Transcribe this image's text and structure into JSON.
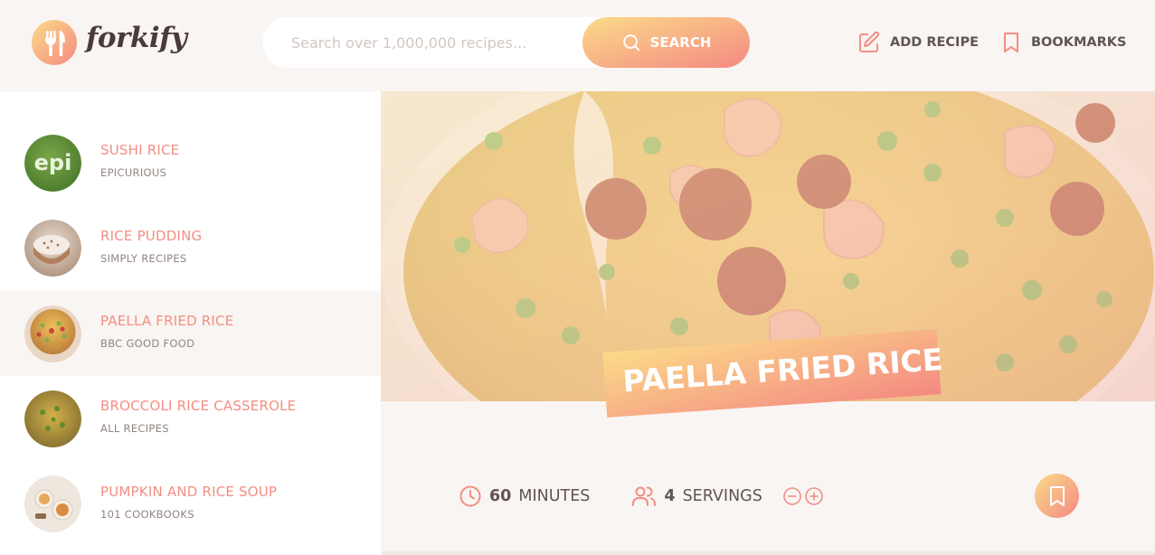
{
  "app": {
    "logo_text": "forkify"
  },
  "search": {
    "placeholder": "Search over 1,000,000 recipes...",
    "button_label": "Search"
  },
  "nav": {
    "add_recipe": "Add recipe",
    "bookmarks": "Bookmarks"
  },
  "results": [
    {
      "title": "Sushi Rice",
      "publisher": "Epicurious",
      "thumb_text": "epi",
      "active": false
    },
    {
      "title": "Rice Pudding",
      "publisher": "Simply Recipes",
      "active": false
    },
    {
      "title": "Paella Fried Rice",
      "publisher": "BBC Good Food",
      "active": true
    },
    {
      "title": "Broccoli Rice Casserole",
      "publisher": "All Recipes",
      "active": false
    },
    {
      "title": "Pumpkin and Rice Soup",
      "publisher": "101 Cookbooks",
      "active": false
    }
  ],
  "recipe": {
    "title": "Paella Fried Rice",
    "cooking_time": "60",
    "cooking_time_unit": "minutes",
    "servings": "4",
    "servings_unit": "servings"
  },
  "colors": {
    "accent_start": "#fbdb89",
    "accent_end": "#f48982",
    "title_color": "#f38e82"
  },
  "icons": {
    "logo": "fork-knife-icon",
    "search": "search-icon",
    "add_recipe": "edit-icon",
    "bookmarks": "bookmark-icon",
    "time": "clock-icon",
    "servings": "users-icon",
    "decrease": "minus-circle-icon",
    "increase": "plus-circle-icon",
    "bookmark_recipe": "bookmark-icon"
  }
}
